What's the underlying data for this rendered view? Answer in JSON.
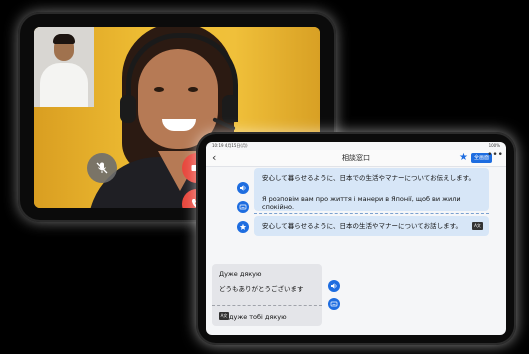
{
  "video_call": {
    "controls": {
      "mute_icon": "mic-off-icon",
      "camera_icon": "video-camera-icon",
      "end_call_icon": "phone-icon"
    },
    "colors": {
      "end_call": "#e8463c",
      "background": "#efbe34"
    }
  },
  "chat": {
    "status_bar": {
      "time": "10:19 4月15日(月)",
      "battery": "100%"
    },
    "header": {
      "title": "相談窓口",
      "fullscreen_label": "全画面",
      "more_label": "•••"
    },
    "messages": [
      {
        "side": "right",
        "original": "安心して暮らせるように、日本での生活やマナーについてお伝えします。",
        "translation": "Я розповім вам про життя і манери в Японії, щоб ви жили спокійно."
      },
      {
        "side": "right",
        "back_translation": "安心して暮らせるように、日本の生活やマナーについてお話します。",
        "badge": "A文"
      },
      {
        "side": "left",
        "original": "Дуже дякую",
        "translation": "どうもありがとうございます",
        "back_translation": "дуже тобі дякую",
        "badge": "A文"
      }
    ],
    "colors": {
      "accent": "#1e6de0",
      "bubble_right": "#d7e6f7",
      "bubble_left": "#e4e5e9"
    }
  }
}
